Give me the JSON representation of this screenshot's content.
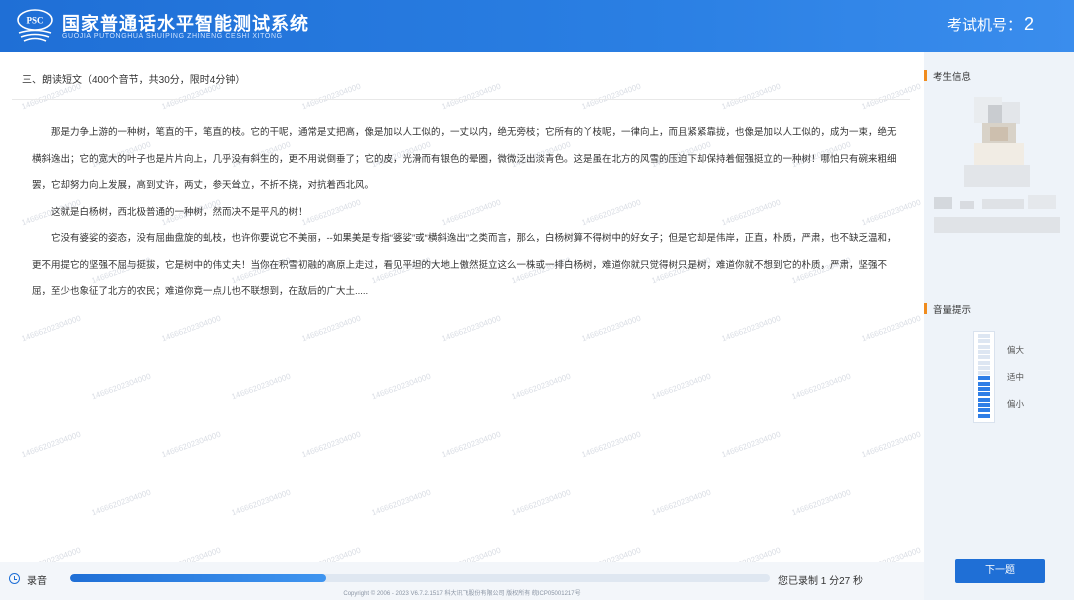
{
  "header": {
    "logo_text": "PSC",
    "title": "国家普通话水平智能测试系统",
    "subtitle": "GUOJIA PUTONGHUA SHUIPING ZHINENG CESHI XITONG",
    "exam_no_label": "考试机号：",
    "exam_no_value": "2"
  },
  "main": {
    "section_title": "三、朗读短文（400个音节，共30分，限时4分钟）",
    "paragraphs": [
      "那是力争上游的一种树，笔直的干，笔直的枝。它的干呢，通常是丈把高，像是加以人工似的，一丈以内，绝无旁枝；它所有的丫枝呢，一律向上，而且紧紧靠拢，也像是加以人工似的，成为一束，绝无横斜逸出；它的宽大的叶子也是片片向上，几乎没有斜生的，更不用说倒垂了；它的皮，光滑而有银色的晕圈，微微泛出淡青色。这是虽在北方的风雪的压迫下却保持着倔强挺立的一种树！哪怕只有碗来粗细罢，它却努力向上发展，高到丈许，两丈，参天耸立，不折不挠，对抗着西北风。",
      "这就是白杨树，西北极普通的一种树，然而决不是平凡的树！",
      "它没有婆娑的姿态，没有屈曲盘旋的虬枝，也许你要说它不美丽，--如果美是专指“婆娑”或“横斜逸出”之类而言，那么，白杨树算不得树中的好女子；但是它却是伟岸，正直，朴质，严肃，也不缺乏温和，更不用提它的坚强不屈与挺拔，它是树中的伟丈夫！当你在积雪初融的高原上走过，看见平坦的大地上傲然挺立这么一株或一排白杨树，难道你就只觉得树只是树，难道你就不想到它的朴质，严肃，坚强不屈，至少也象征了北方的农民；难道你竟一点儿也不联想到，在敌后的广大土....."
    ],
    "watermark": "14666202304000"
  },
  "side": {
    "candidate_info_label": "考生信息",
    "volume_label": "音量提示",
    "volume_levels": [
      "偏大",
      "适中",
      "偏小"
    ],
    "volume_level_fraction": 0.5,
    "next_button": "下一题"
  },
  "bottom": {
    "record_label": "录音",
    "progress_fraction": 0.365,
    "record_time": "您已录制 1 分27 秒",
    "copyright": "Copyright © 2006 - 2023 V6.7.2.1517 科大讯飞股份有限公司 版权所有 皖ICP05001217号"
  },
  "colors": {
    "brand_blue": "#1f6fd6",
    "accent_orange": "#f08c1e",
    "panel_bg": "#eef3f9"
  }
}
